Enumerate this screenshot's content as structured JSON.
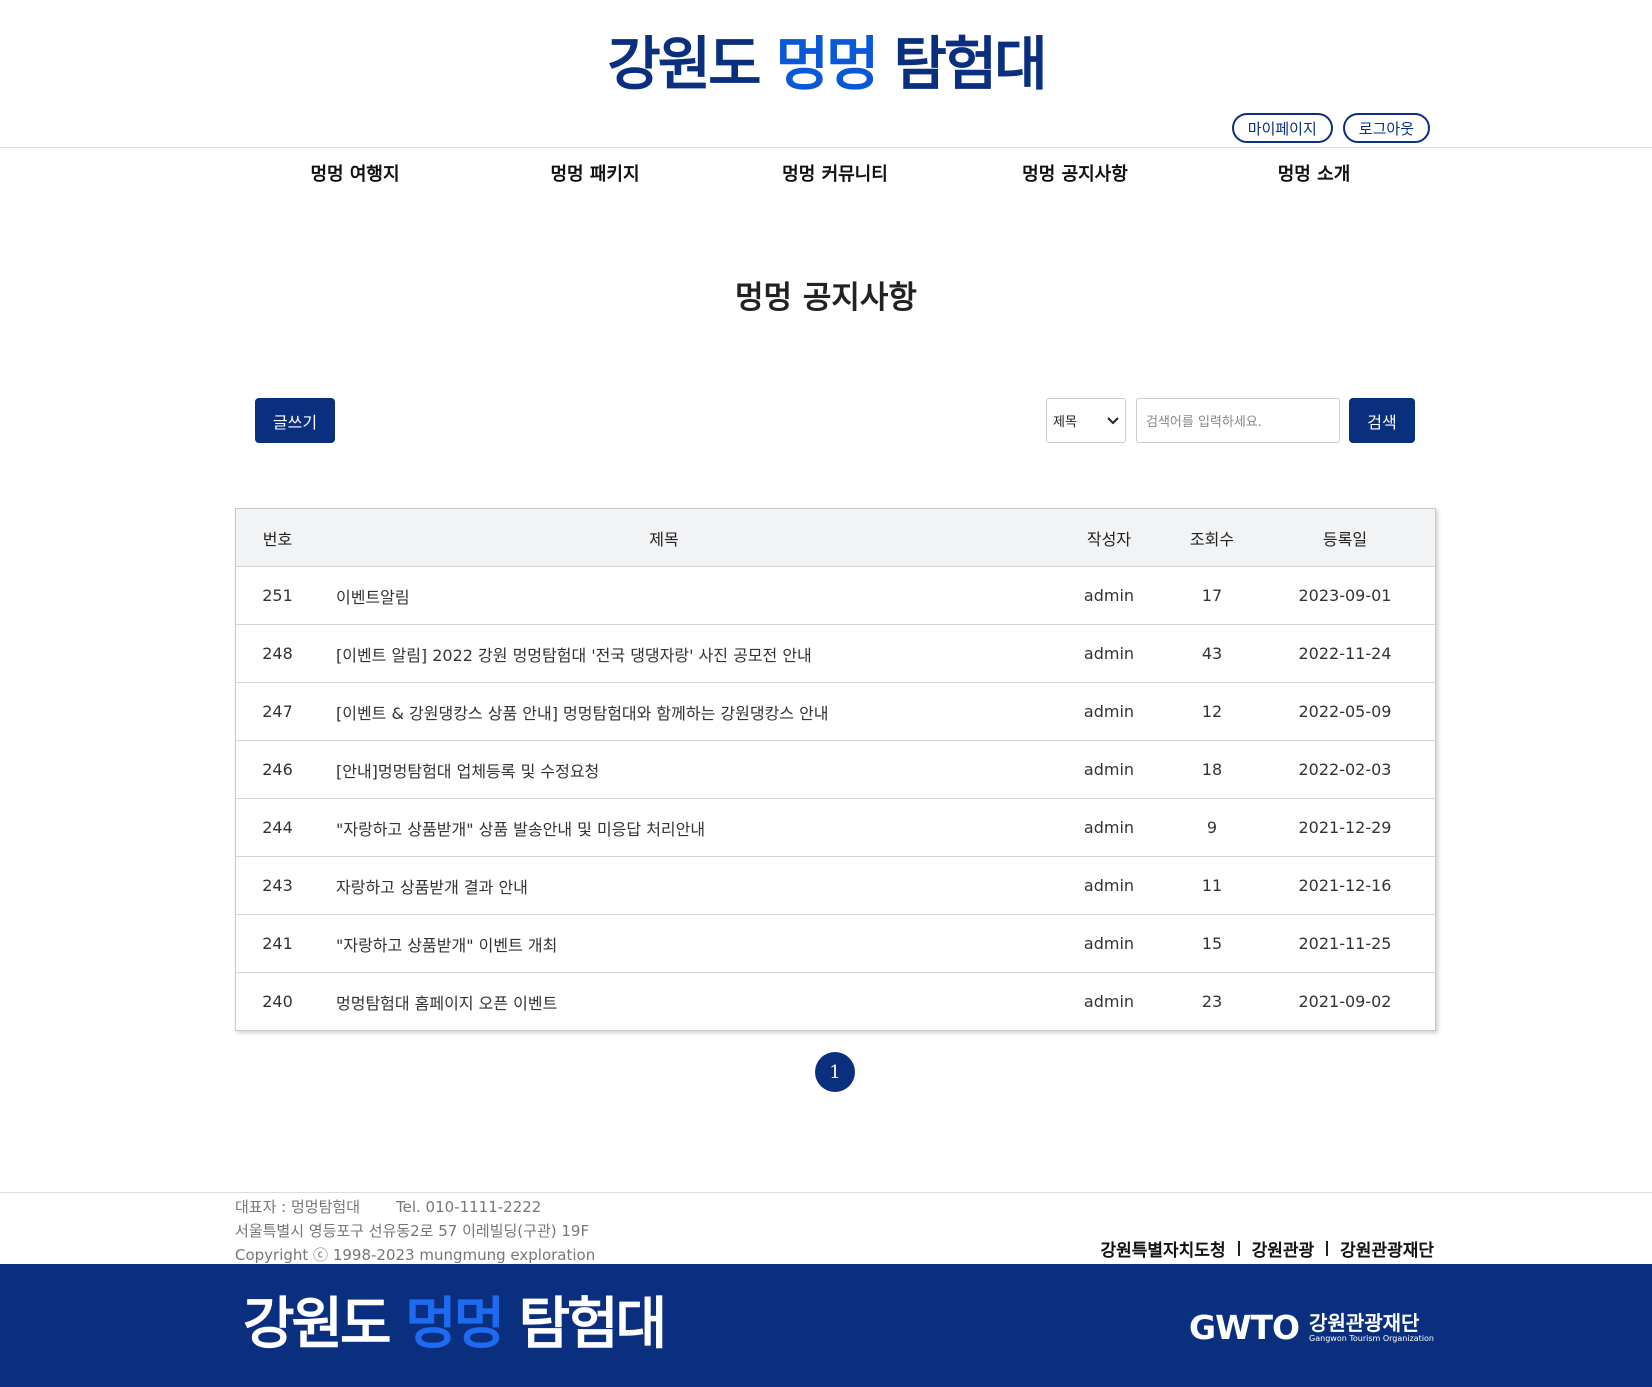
{
  "header": {
    "logo_part1": "강원도 ",
    "logo_part2": "멍멍",
    "logo_part3": " 탐험대",
    "mypage": "마이페이지",
    "logout": "로그아웃"
  },
  "nav": [
    "멍멍 여행지",
    "멍멍 패키지",
    "멍멍 커뮤니티",
    "멍멍 공지사항",
    "멍멍 소개"
  ],
  "page_title": "멍멍 공지사항",
  "toolbar": {
    "write_label": "글쓰기",
    "search_field_value": "제목",
    "search_placeholder": "검색어를 입력하세요.",
    "search_label": "검색"
  },
  "table": {
    "columns": [
      "번호",
      "제목",
      "작성자",
      "조회수",
      "등록일"
    ],
    "rows": [
      {
        "no": "251",
        "title": "이벤트알림",
        "writer": "admin",
        "views": "17",
        "date": "2023-09-01"
      },
      {
        "no": "248",
        "title": "[이벤트 알림] 2022 강원 멍멍탐험대 '전국 댕댕자랑' 사진 공모전 안내",
        "writer": "admin",
        "views": "43",
        "date": "2022-11-24"
      },
      {
        "no": "247",
        "title": "[이벤트 & 강원댕캉스 상품 안내] 멍멍탐험대와 함께하는 강원댕캉스 안내",
        "writer": "admin",
        "views": "12",
        "date": "2022-05-09"
      },
      {
        "no": "246",
        "title": "[안내]멍멍탐험대 업체등록 및 수정요청",
        "writer": "admin",
        "views": "18",
        "date": "2022-02-03"
      },
      {
        "no": "244",
        "title": "\"자랑하고 상품받개\" 상품 발송안내 및 미응답 처리안내",
        "writer": "admin",
        "views": "9",
        "date": "2021-12-29"
      },
      {
        "no": "243",
        "title": "자랑하고 상품받개 결과 안내",
        "writer": "admin",
        "views": "11",
        "date": "2021-12-16"
      },
      {
        "no": "241",
        "title": "\"자랑하고 상품받개\" 이벤트 개최",
        "writer": "admin",
        "views": "15",
        "date": "2021-11-25"
      },
      {
        "no": "240",
        "title": "멍멍탐험대 홈페이지 오픈 이벤트",
        "writer": "admin",
        "views": "23",
        "date": "2021-09-02"
      }
    ]
  },
  "pagination": {
    "current": "1"
  },
  "footer": {
    "rep": "대표자 : 멍멍탐험대",
    "tel": "Tel. 010-1111-2222",
    "address": "서울특별시 영등포구 선유동2로 57 이레빌딩(구관) 19F",
    "copyright": "Copyright ⓒ 1998-2023 mungmung exploration",
    "links": [
      "강원특별자치도청",
      "강원관광",
      "강원관광재단"
    ],
    "gwto_mark": "GWTO",
    "gwto_kr": "강원관광재단",
    "gwto_en": "Gangwon Tourism Organization"
  },
  "colors": {
    "primary": "#0b2f7f",
    "accent": "#0a58d6",
    "header_bg": "#f2f3f5"
  }
}
